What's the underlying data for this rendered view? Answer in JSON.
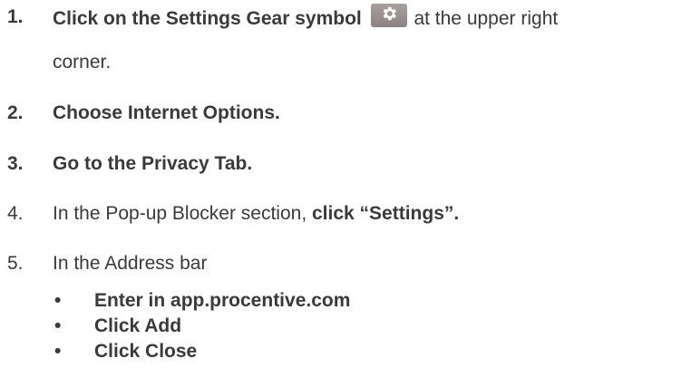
{
  "steps": [
    {
      "number": "1.",
      "text_bold": "Click on the Settings Gear symbol",
      "icon": "gear-icon",
      "text_after": "at the upper right",
      "text_continued": "corner."
    },
    {
      "number": "2.",
      "text_bold": "Choose Internet Options."
    },
    {
      "number": "3.",
      "text_bold": "Go to the Privacy Tab."
    },
    {
      "number": "4.",
      "text_regular": "In the Pop-up Blocker section, ",
      "text_bold": "click “Settings”."
    },
    {
      "number": "5.",
      "text_regular": "In the Address bar",
      "bullets": [
        "Enter in app.procentive.com",
        "Click Add",
        "Click Close"
      ]
    }
  ],
  "bullet_glyph": "•",
  "colors": {
    "text": "#3a3a3a",
    "gear_background": "#958b8b",
    "gear_icon": "#ffffff"
  }
}
